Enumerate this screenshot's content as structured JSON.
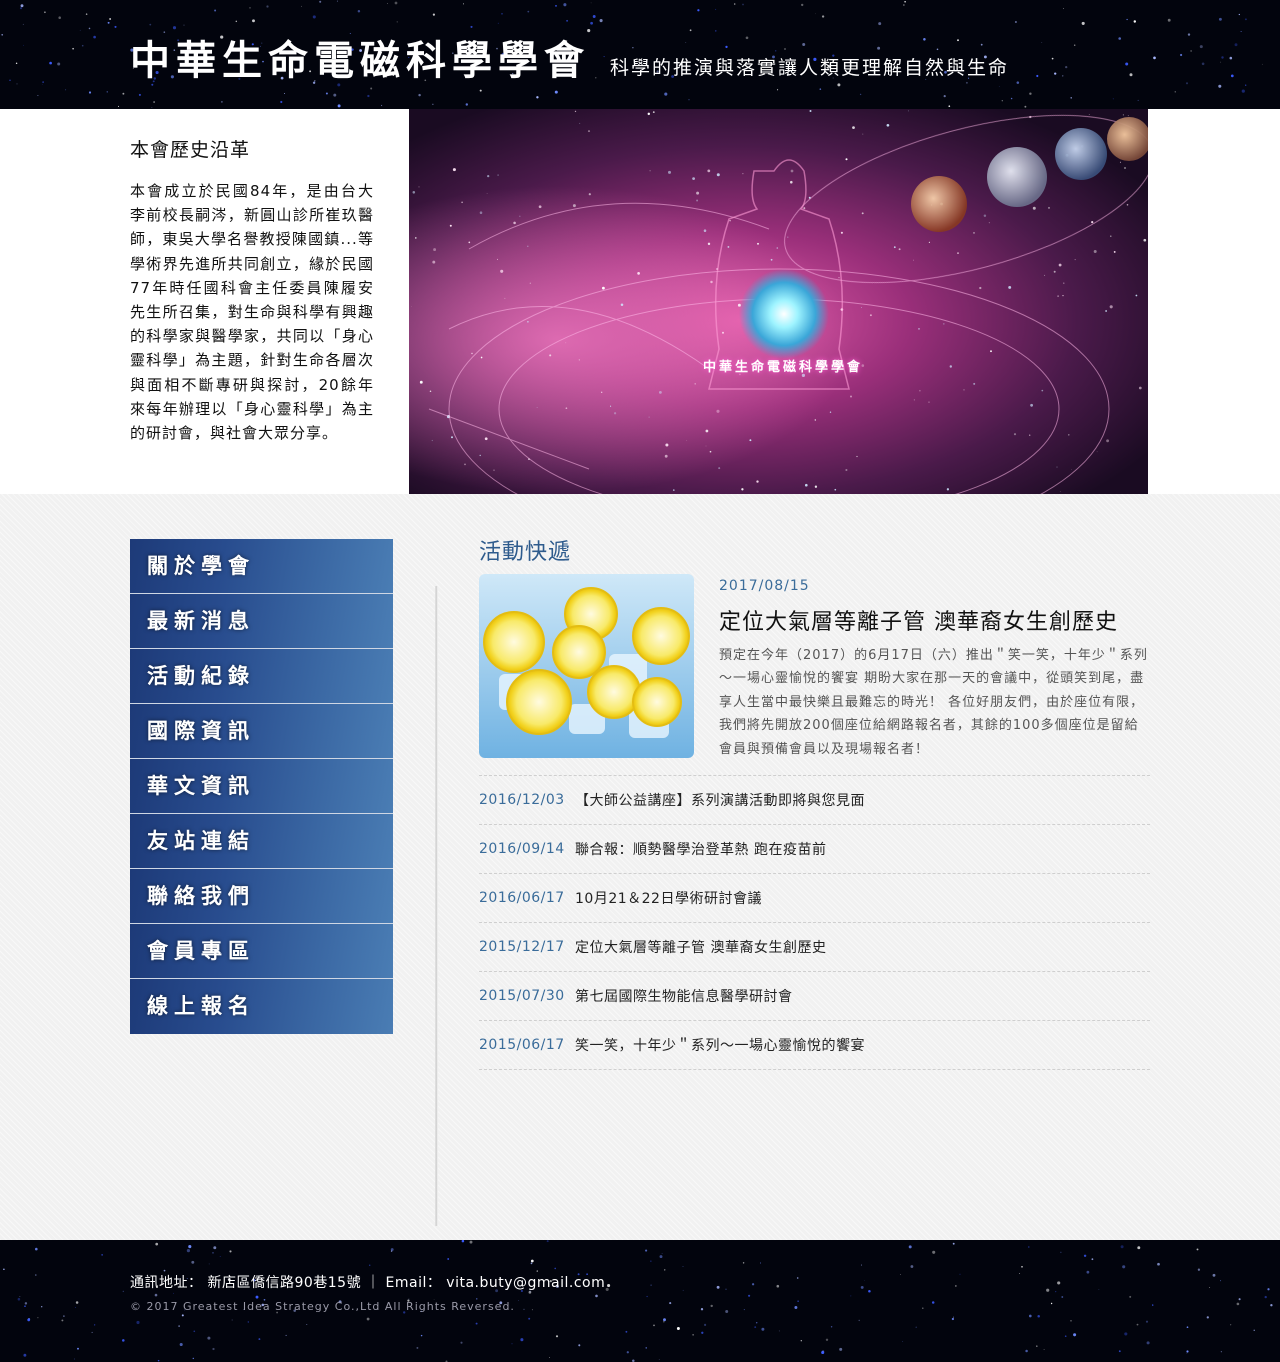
{
  "header": {
    "title": "中華生命電磁科學學會",
    "slogan": "科學的推演與落實讓人類更理解自然與生命"
  },
  "intro": {
    "heading": "本會歷史沿革",
    "body": "本會成立於民國84年，是由台大李前校長嗣涔，新圓山診所崔玖醫師，東吳大學名譽教授陳國鎮...等學術界先進所共同創立，緣於民國77年時任國科會主任委員陳履安先生所召集，對生命與科學有興趣的科學家與醫學家，共同以「身心靈科學」為主題，針對生命各層次與面相不斷專研與探討，20餘年來每年辦理以「身心靈科學」為主的研討會，與社會大眾分享。",
    "banner_caption": "中華生命電磁科學學會"
  },
  "nav": {
    "items": [
      {
        "label": "關於學會"
      },
      {
        "label": "最新消息"
      },
      {
        "label": "活動紀錄"
      },
      {
        "label": "國際資訊"
      },
      {
        "label": "華文資訊"
      },
      {
        "label": "友站連結"
      },
      {
        "label": "聯絡我們"
      },
      {
        "label": "會員專區"
      },
      {
        "label": "線上報名"
      }
    ]
  },
  "news": {
    "section_title": "活動快遞",
    "featured": {
      "date": "2017/08/15",
      "title": "定位大氣層等離子管 澳華裔女生創歷史",
      "description": "預定在今年（2017）的6月17日（六）推出＂笑一笑，十年少＂系列～一場心靈愉悅的饗宴 期盼大家在那一天的會議中，從頭笑到尾，盡享人生當中最快樂且最難忘的時光！ 各位好朋友們，由於座位有限，我們將先開放200個座位給網路報名者，其餘的100多個座位是留給會員與預備會員以及現場報名者！",
      "image_icon": "lemon-slices-image"
    },
    "items": [
      {
        "date": "2016/12/03",
        "title": "【大師公益講座】系列演講活動即將與您見面"
      },
      {
        "date": "2016/09/14",
        "title": "聯合報：順勢醫學治登革熱 跑在疫苗前"
      },
      {
        "date": "2016/06/17",
        "title": "10月21＆22日學術研討會議"
      },
      {
        "date": "2015/12/17",
        "title": "定位大氣層等離子管 澳華裔女生創歷史"
      },
      {
        "date": "2015/07/30",
        "title": "第七屆國際生物能信息醫學研討會"
      },
      {
        "date": "2015/06/17",
        "title": "笑一笑，十年少＂系列～一場心靈愉悅的饗宴"
      }
    ]
  },
  "footer": {
    "address_label": "通訊地址：",
    "address": "新店區僑信路90巷15號",
    "separator": "｜",
    "email_label": "Email：",
    "email": "vita.buty@gmail.com",
    "copyright": "© 2017 Greatest Idea Strategy Co.,Ltd All Rights Reversed."
  },
  "colors": {
    "header_bg": "#02040d",
    "nav_blue": "#284c8e",
    "date_blue": "#3a6c9a",
    "section_title": "#2e5b8d"
  }
}
